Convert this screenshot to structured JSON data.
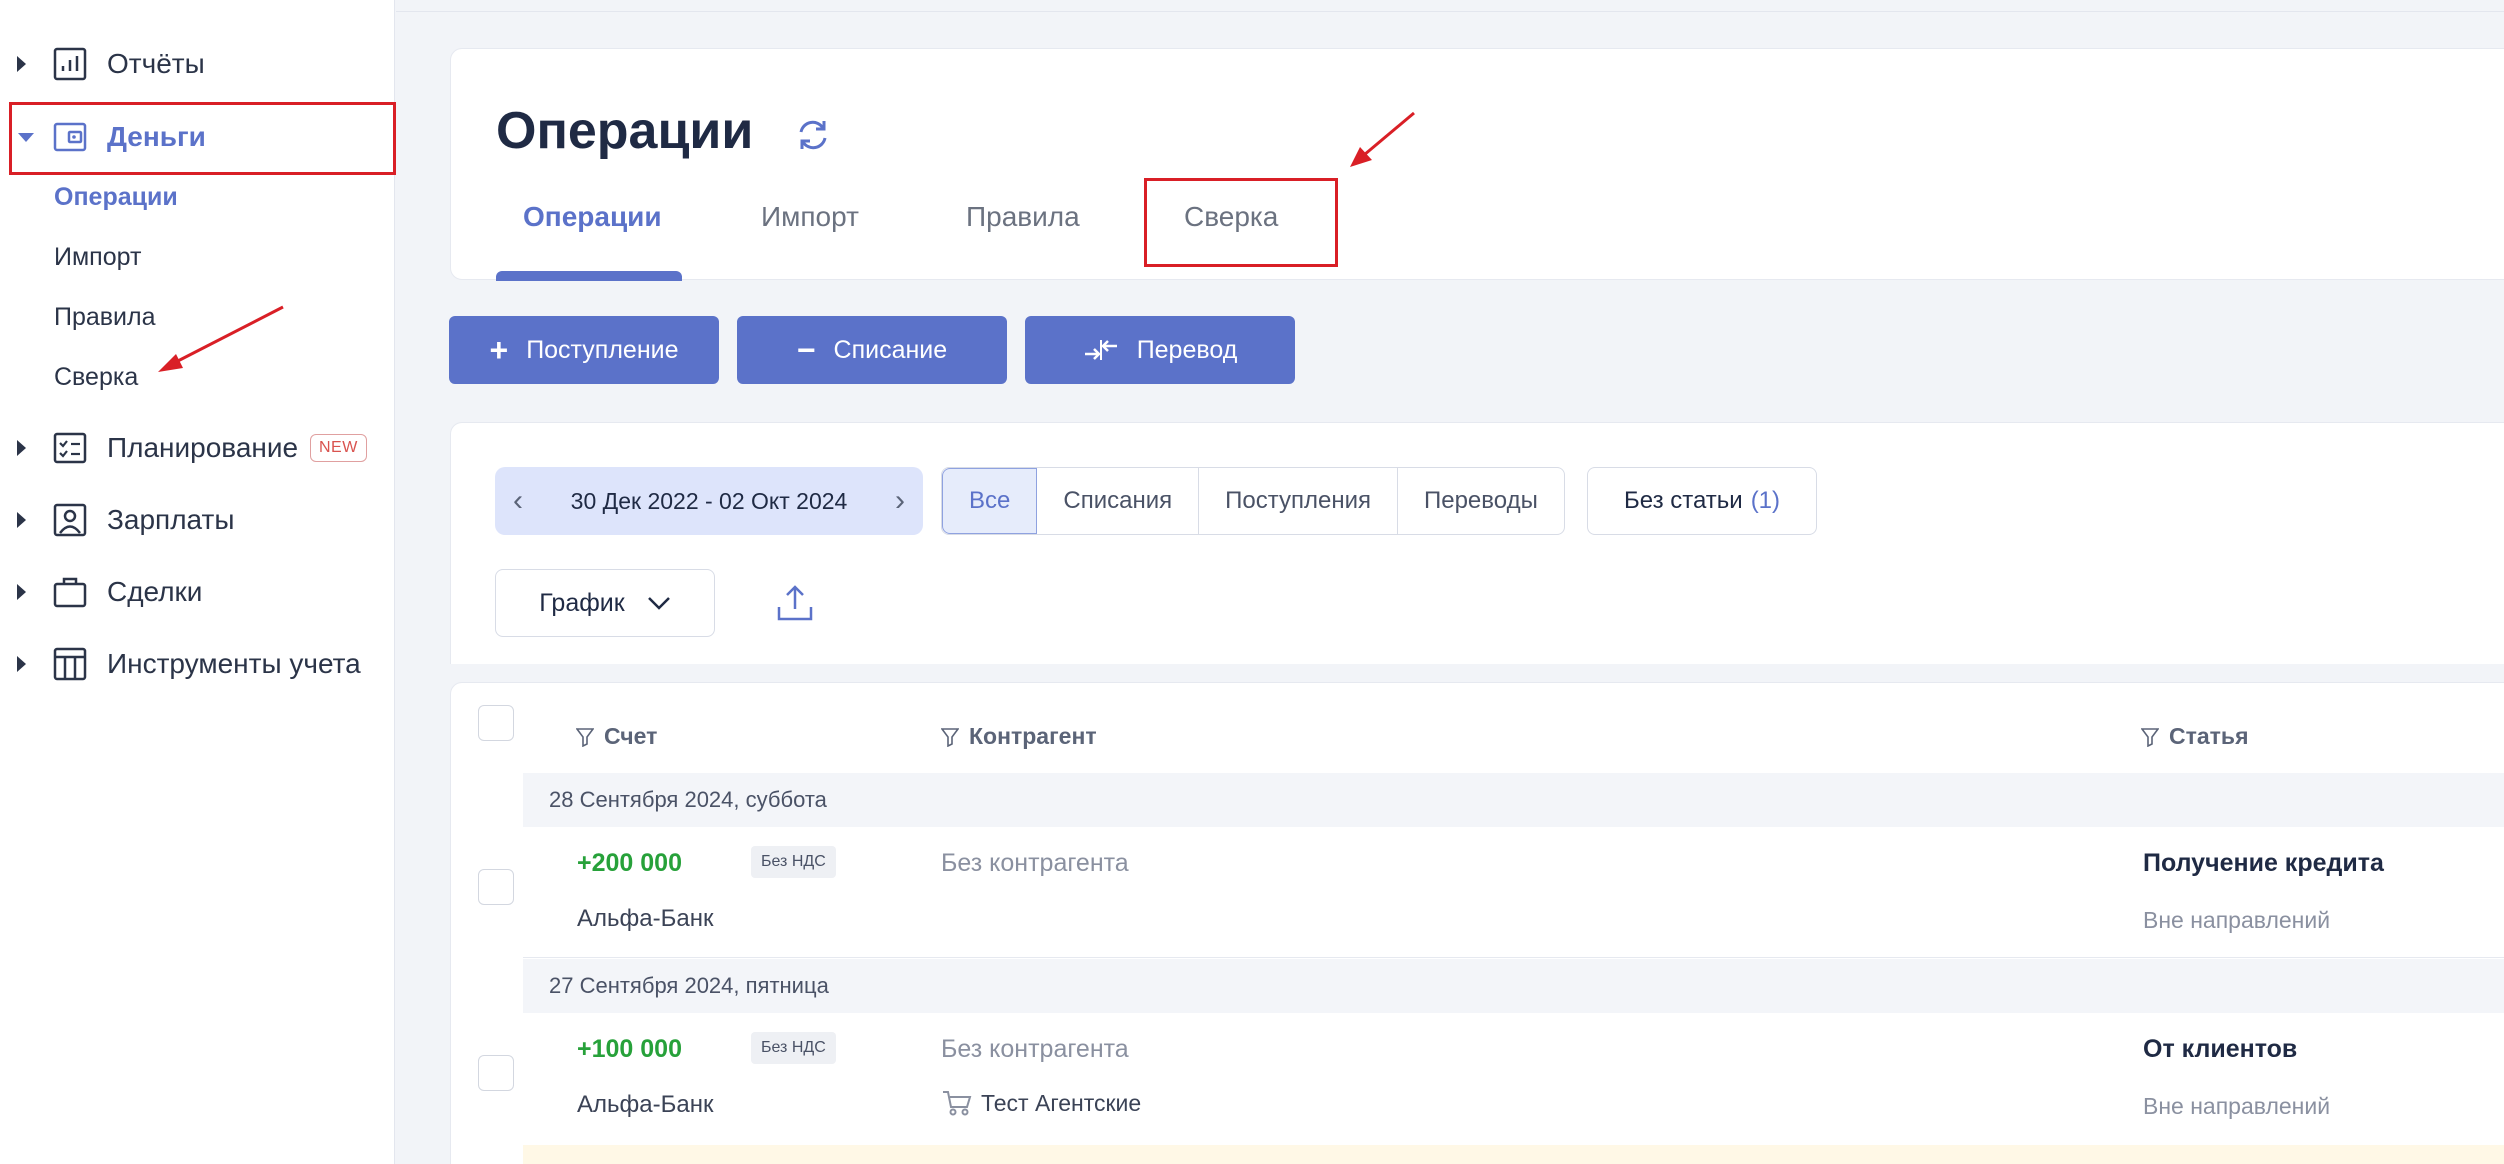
{
  "sidebar": {
    "reports": "Отчёты",
    "money": "Деньги",
    "money_sub": [
      "Операции",
      "Импорт",
      "Правила",
      "Сверка"
    ],
    "planning": "Планирование",
    "new_badge": "NEW",
    "salaries": "Зарплаты",
    "deals": "Сделки",
    "tools": "Инструменты учета"
  },
  "header": {
    "title": "Операции",
    "tabs": [
      "Операции",
      "Импорт",
      "Правила",
      "Сверка"
    ]
  },
  "actions": {
    "income": "Поступление",
    "income_sym": "+",
    "expense": "Списание",
    "expense_sym": "−",
    "transfer": "Перевод"
  },
  "filters": {
    "date_range": "30 Дек 2022 - 02 Окт 2024",
    "segments": [
      "Все",
      "Списания",
      "Поступления",
      "Переводы"
    ],
    "no_article": "Без статьи",
    "no_article_count": "(1)",
    "graph": "График"
  },
  "table": {
    "columns": {
      "account": "Счет",
      "counterparty": "Контрагент",
      "article": "Статья"
    },
    "groups": [
      {
        "date": "28 Сентября 2024, суббота",
        "amount": "+200 000",
        "vat": "Без НДС",
        "bank": "Альфа-Банк",
        "counterparty": "Без контрагента",
        "agent": "",
        "article": "Получение кредита",
        "direction": "Вне направлений"
      },
      {
        "date": "27 Сентября 2024, пятница",
        "amount": "+100 000",
        "vat": "Без НДС",
        "bank": "Альфа-Банк",
        "counterparty": "Без контрагента",
        "agent": "Тест Агентские",
        "article": "От клиентов",
        "direction": "Вне направлений"
      }
    ]
  },
  "colors": {
    "accent": "#5b72c9",
    "positive": "#27a13a",
    "annotation": "#d91f26"
  }
}
